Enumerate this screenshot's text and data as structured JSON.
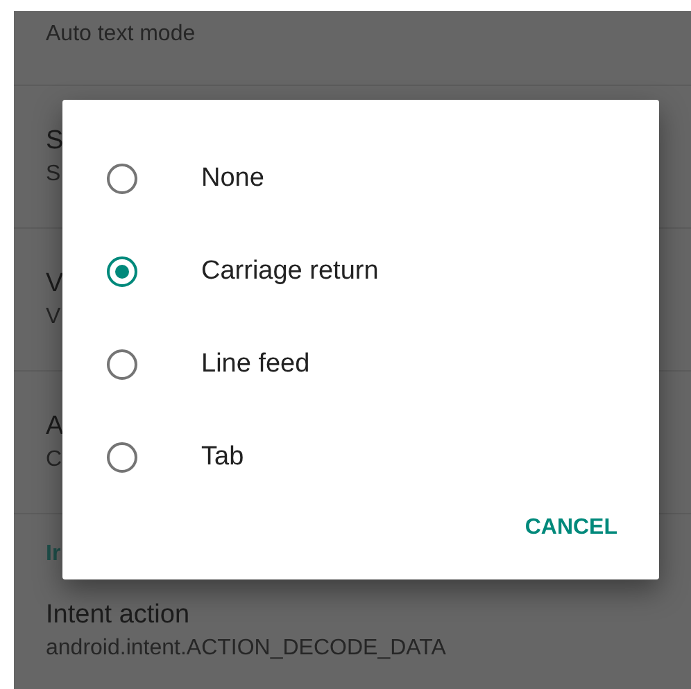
{
  "settings": [
    {
      "summary": "Auto text mode"
    },
    {
      "title": "S",
      "summary": "S"
    },
    {
      "title": "V",
      "summary": "V"
    },
    {
      "title": "A",
      "summary": "C"
    }
  ],
  "section_header": "Ir",
  "intent": {
    "title": "Intent action",
    "summary": "android.intent.ACTION_DECODE_DATA"
  },
  "dialog": {
    "options": [
      {
        "label": "None",
        "selected": false
      },
      {
        "label": "Carriage return",
        "selected": true
      },
      {
        "label": "Line feed",
        "selected": false
      },
      {
        "label": "Tab",
        "selected": false
      }
    ],
    "buttons": [
      "CANCEL"
    ]
  }
}
